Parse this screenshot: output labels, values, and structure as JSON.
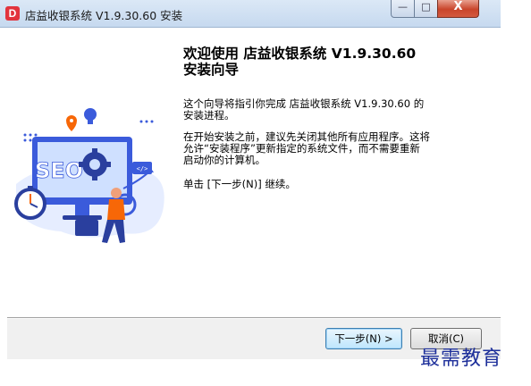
{
  "window": {
    "title": "店益收银系统 V1.9.30.60 安装",
    "app_icon_letter": "D"
  },
  "controls": {
    "minimize": "—",
    "maximize": "□",
    "close": "X"
  },
  "main": {
    "heading_line1": "欢迎使用 店益收银系统 V1.9.30.60",
    "heading_line2": "安装向导",
    "para1_line1": "这个向导将指引你完成 店益收银系统 V1.9.30.60 的",
    "para1_line2": "安装进程。",
    "para2_line1": "在开始安装之前，建议先关闭其他所有应用程序。这将",
    "para2_line2": "允许“安装程序”更新指定的系统文件，而不需要重新",
    "para2_line3": "启动你的计算机。",
    "para3": "单击 [下一步(N)] 继续。"
  },
  "illustration": {
    "screen_text": "SEO",
    "code_tag": "</>",
    "colors": {
      "primary": "#3b5bdb",
      "accent": "#f76707",
      "light": "#cfe0ff"
    }
  },
  "buttons": {
    "next_label": "下一步(N) >",
    "cancel_label": "取消(C)"
  },
  "watermark": "最需教育"
}
